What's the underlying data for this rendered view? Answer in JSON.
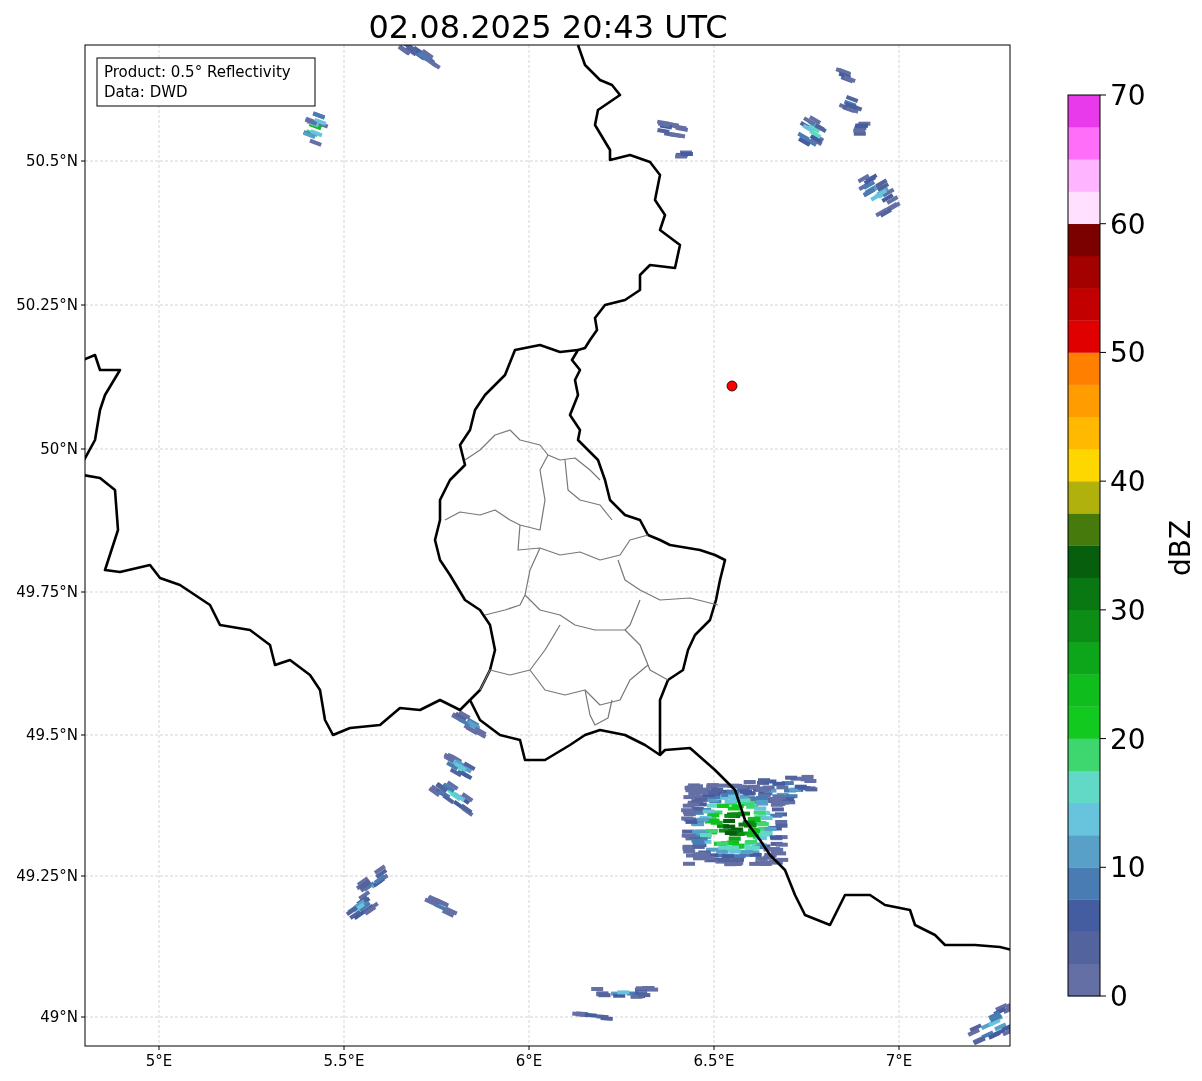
{
  "title": "02.08.2025 20:43 UTC",
  "info_box": [
    "Product: 0.5° Reflectivity",
    "Data: DWD"
  ],
  "x_ticks": [
    "5°E",
    "5.5°E",
    "6°E",
    "6.5°E",
    "7°E"
  ],
  "y_ticks": [
    "50.5°N",
    "50.25°N",
    "50°N",
    "49.75°N",
    "49.5°N",
    "49.25°N",
    "49°N"
  ],
  "colorbar": {
    "label": "dBZ",
    "ticks": [
      "70",
      "60",
      "50",
      "40",
      "30",
      "20",
      "10",
      "0"
    ],
    "bins": [
      {
        "color": "#6470a5"
      },
      {
        "color": "#52639e"
      },
      {
        "color": "#445da0"
      },
      {
        "color": "#4a7cb4"
      },
      {
        "color": "#58a0c8"
      },
      {
        "color": "#67c4dc"
      },
      {
        "color": "#61d9c6"
      },
      {
        "color": "#3dd66f"
      },
      {
        "color": "#11c91f"
      },
      {
        "color": "#0fbd1c"
      },
      {
        "color": "#0da61a"
      },
      {
        "color": "#0c8e16"
      },
      {
        "color": "#0a7812"
      },
      {
        "color": "#075e0d"
      },
      {
        "color": "#467a0c"
      },
      {
        "color": "#b0b10c"
      },
      {
        "color": "#ffd700"
      },
      {
        "color": "#ffb900"
      },
      {
        "color": "#ff9c00"
      },
      {
        "color": "#ff7f00"
      },
      {
        "color": "#e00000"
      },
      {
        "color": "#c20000"
      },
      {
        "color": "#a30000"
      },
      {
        "color": "#7b0000"
      },
      {
        "color": "#ffe0ff"
      },
      {
        "color": "#ffb4ff"
      },
      {
        "color": "#ff6ef8"
      },
      {
        "color": "#e83aeb"
      }
    ]
  }
}
